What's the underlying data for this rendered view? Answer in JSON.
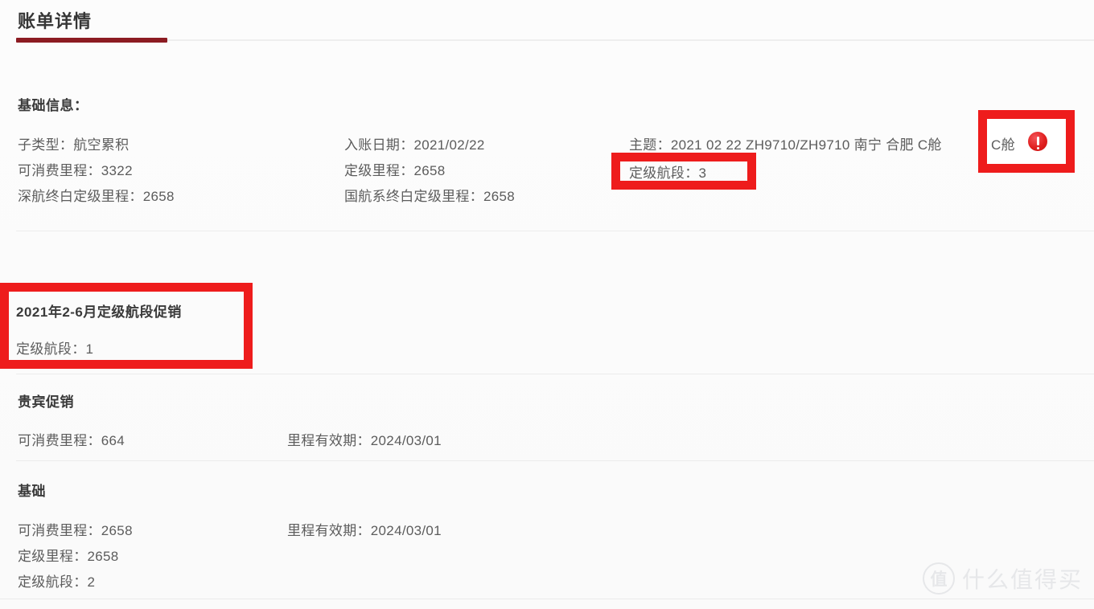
{
  "header": {
    "title": "账单详情",
    "accent_color": "#8c1c22"
  },
  "basic_info": {
    "heading": "基础信息：",
    "col1": [
      "子类型：航空累积",
      "可消费里程：3322",
      "深航终白定级里程：2658"
    ],
    "col2": [
      "入账日期：2021/02/22",
      "定级里程：2658",
      "国航系终白定级里程：2658"
    ],
    "col3": {
      "subject": "主题：2021 02 22 ZH9710/ZH9710 南宁 合肥 C舱",
      "grade_segments": "定级航段：3",
      "alert_icon": "alert-exclamation-icon"
    }
  },
  "promotion_section": {
    "heading": "2021年2-6月定级航段促销",
    "lines": [
      "定级航段：1"
    ]
  },
  "vip_section": {
    "heading": "贵宾促销",
    "col1": [
      "可消费里程：664"
    ],
    "col2": [
      "里程有效期：2024/03/01"
    ]
  },
  "base_section": {
    "heading": "基础",
    "col1": [
      "可消费里程：2658",
      "定级里程：2658",
      "定级航段：2"
    ],
    "col2": [
      "里程有效期：2024/03/01"
    ]
  },
  "annotations": {
    "highlight_color": "#ee1c1c",
    "boxes": [
      "grade-segment-highlight",
      "alert-icon-highlight",
      "promotion-block-highlight"
    ]
  },
  "watermark": {
    "logo_char": "值",
    "text": "什么值得买"
  }
}
